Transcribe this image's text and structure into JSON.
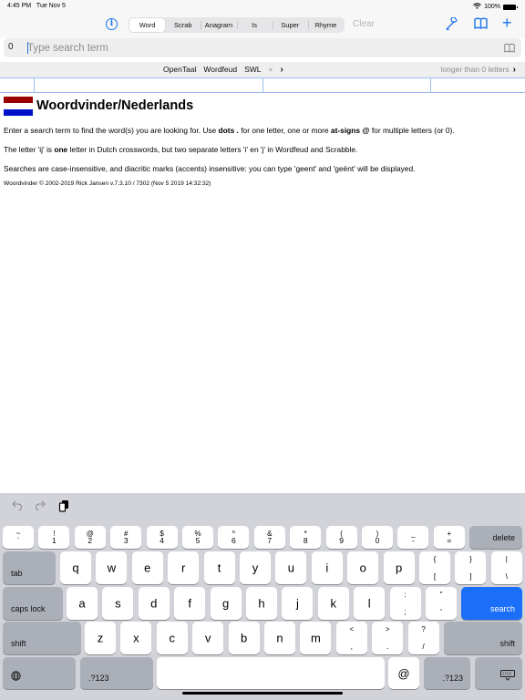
{
  "status_bar": {
    "time": "4:45 PM",
    "date": "Tue Nov 5",
    "battery": "100%"
  },
  "toolbar": {
    "info_icon": "info-circle-icon",
    "segments": [
      "Word",
      "Scrab",
      "Anagram",
      "Is",
      "Super",
      "Rhyme"
    ],
    "active_segment": "Word",
    "clear_label": "Clear",
    "right_icons": [
      "wrench-icon",
      "book-icon",
      "plus-icon"
    ],
    "accent_color": "#1a73e8"
  },
  "search": {
    "count": "0",
    "placeholder": "Type search term",
    "value": ""
  },
  "filter_bar": {
    "lists": [
      "OpenTaal",
      "Wordfeud",
      "SWL"
    ],
    "more": "+",
    "length_filter": "longer than 0 letters"
  },
  "content": {
    "title": "Woordvinder/Nederlands",
    "flag_colors": {
      "red": "#9a0000",
      "white": "#ffffff",
      "blue": "#0010c8"
    },
    "para1": {
      "a": "Enter a search term to find the word(s) you are looking for. Use ",
      "b1": "dots .",
      "c": " for one letter, one or more ",
      "b2": "at-signs @",
      "d": " for multiple letters (or 0)."
    },
    "para2": {
      "a": "The letter 'ij' is ",
      "b": "one",
      "c": " letter in Dutch crosswords, but two separate letters 'i' en 'j' in Wordfeud and Scrabble."
    },
    "para3": "Searches are case-insensitive, and diacritic marks (accents) insensitive: you can type 'geent' and 'geënt' will be displayed.",
    "copyright": "Woordvinder © 2002-2019 Rick Jansen v.7.3.10 / 7302 (Nov 5 2019 14:32:32)"
  },
  "keyboard": {
    "shortcuts": [
      "undo-icon",
      "redo-icon",
      "paste-icon"
    ],
    "row1": [
      [
        "~",
        "`"
      ],
      [
        "!",
        "1"
      ],
      [
        "@",
        "2"
      ],
      [
        "#",
        "3"
      ],
      [
        "$",
        "4"
      ],
      [
        "%",
        "5"
      ],
      [
        "^",
        "6"
      ],
      [
        "&",
        "7"
      ],
      [
        "*",
        "8"
      ],
      [
        "(",
        "9"
      ],
      [
        ")",
        "0"
      ],
      [
        "_",
        "-"
      ],
      [
        "+",
        "="
      ]
    ],
    "delete": "delete",
    "tab": "tab",
    "row2": [
      "q",
      "w",
      "e",
      "r",
      "t",
      "y",
      "u",
      "i",
      "o",
      "p"
    ],
    "row2_sym": [
      [
        "{",
        "["
      ],
      [
        "}",
        "]"
      ],
      [
        "|",
        "\\"
      ]
    ],
    "caps": "caps lock",
    "row3": [
      "a",
      "s",
      "d",
      "f",
      "g",
      "h",
      "j",
      "k",
      "l"
    ],
    "row3_sym": [
      [
        ":",
        ";"
      ],
      [
        "\"",
        "'"
      ]
    ],
    "search": "search",
    "shift": "shift",
    "row4": [
      "z",
      "x",
      "c",
      "v",
      "b",
      "n",
      "m"
    ],
    "row4_sym": [
      [
        "<",
        ","
      ],
      [
        ">",
        "."
      ],
      [
        "?",
        "/"
      ]
    ],
    "numbers": ".?123",
    "at": "@"
  }
}
